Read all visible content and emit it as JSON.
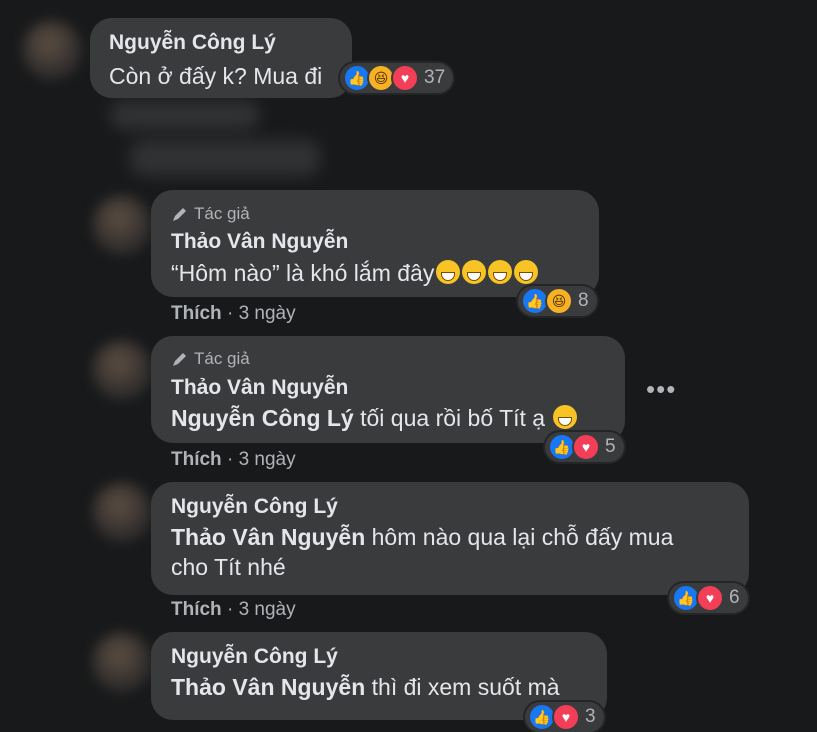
{
  "comments": [
    {
      "author": "Nguyễn Công Lý",
      "text": "Còn ở đấy k? Mua đi",
      "reaction_count": "37"
    },
    {
      "badge": "Tác giả",
      "author": "Thảo Vân Nguyễn",
      "text": "“Hôm nào” là khó lắm đây",
      "reaction_count": "8",
      "like_label": "Thích",
      "time": "3 ngày"
    },
    {
      "badge": "Tác giả",
      "author": "Thảo Vân Nguyễn",
      "mention": "Nguyễn Công Lý",
      "text": " tối qua rồi bố Tít ạ",
      "reaction_count": "5",
      "like_label": "Thích",
      "time": "3 ngày",
      "more": "•••"
    },
    {
      "author": "Nguyễn Công Lý",
      "mention": "Thảo Vân Nguyễn",
      "text": " hôm nào qua lại chỗ đấy mua",
      "text_line2": "cho Tít nhé",
      "reaction_count": "6",
      "like_label": "Thích",
      "time": "3 ngày"
    },
    {
      "author": "Nguyễn Công Lý",
      "mention": "Thảo Vân Nguyễn",
      "text": " thì đi xem suốt mà",
      "reaction_count": "3"
    }
  ],
  "separator": " · ",
  "icons": [
    "pencil-icon",
    "like-reaction-icon",
    "haha-reaction-icon",
    "love-reaction-icon",
    "grin-emoji-icon",
    "smile-emoji-icon",
    "more-options-icon"
  ]
}
